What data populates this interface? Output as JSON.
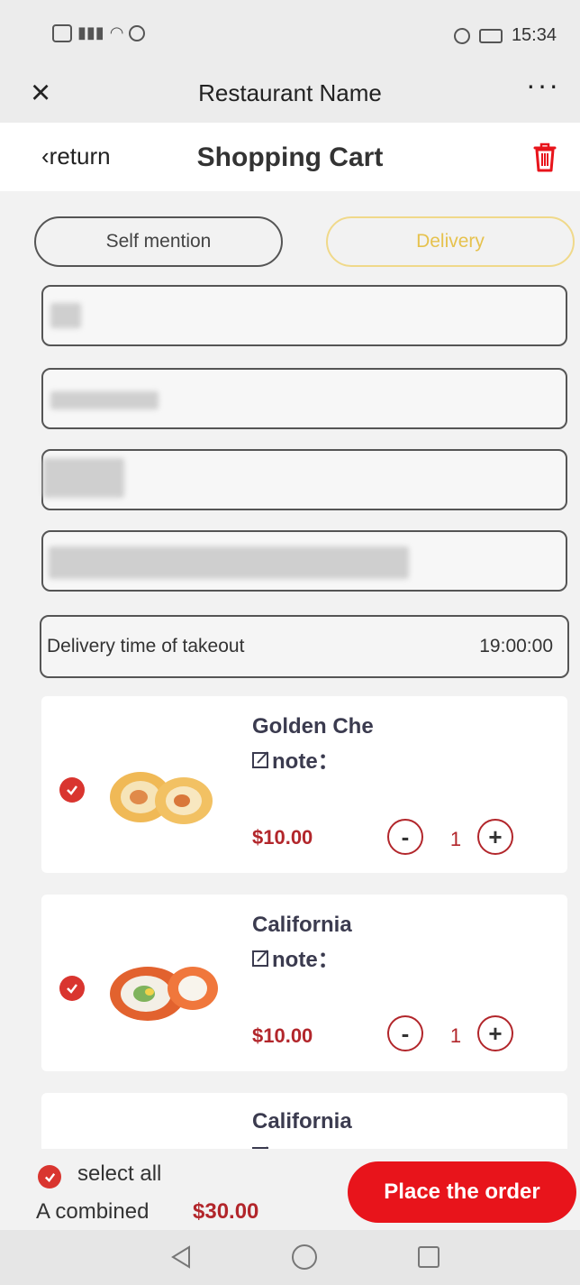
{
  "status_bar": {
    "time": "15:34"
  },
  "titlebar": {
    "title": "Restaurant Name",
    "close_symbol": "×",
    "more_symbol": "···"
  },
  "header": {
    "return_label": "‹return",
    "title": "Shopping Cart"
  },
  "modes": {
    "self": "Self mention",
    "delivery": "Delivery",
    "selected": "Delivery"
  },
  "delivery_time": {
    "label": "Delivery time of takeout",
    "value": "19:00:00"
  },
  "cart": {
    "items": [
      {
        "name": "Golden Che",
        "note_label": "note：",
        "price": "$10.00",
        "qty": "1",
        "checked": true
      },
      {
        "name": "California",
        "note_label": "note：",
        "price": "$10.00",
        "qty": "1",
        "checked": true
      },
      {
        "name": "California",
        "note_label": "note：",
        "price": "",
        "qty": "",
        "checked": true
      }
    ],
    "minus_symbol": "-",
    "plus_symbol": "+"
  },
  "footer": {
    "select_all": "select all",
    "combined_label": "A combined",
    "combined_total": "$30.00",
    "order_button": "Place the order"
  },
  "colors": {
    "accent_red": "#e8141b",
    "price_red": "#b2262b",
    "delivery_gold": "#e6c24e"
  }
}
